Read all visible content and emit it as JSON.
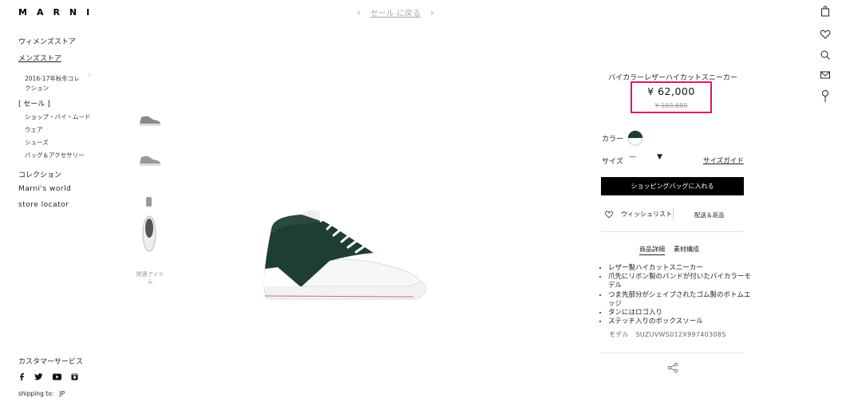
{
  "brand": "MARNI",
  "topnav": {
    "prev": "‹",
    "back_label": "セール に戻る",
    "next": "›"
  },
  "leftnav": {
    "womens": "ウィメンズストア",
    "mens": "メンズストア",
    "collection_2016_line1": "2016-17年秋冬コレ",
    "collection_2016_line2": "クション",
    "sale": "[ セール ]",
    "sale_items": [
      "ショップ・バイ・ムード",
      "ウェア",
      "シューズ",
      "バッグ＆アクセサリー"
    ],
    "collection": "コレクション",
    "marni_world": "Marni's world",
    "store_locator": "store locator"
  },
  "related_items": "関連アイテム",
  "product": {
    "title": "バイカラーレザーハイカットスニーカー",
    "price": "¥ 62,000",
    "old_price": "¥ 103,680",
    "color_label": "カラー",
    "size_label": "サイズ",
    "size_value": "—",
    "size_guide": "サイズガイド",
    "cart_button": "ショッピングバッグに入れる",
    "wishlist": "ウィッシュリスト",
    "shipping": "配送＆返品",
    "tab_details": "商品詳細",
    "tab_material": "素材構成",
    "features": [
      "レザー製ハイカットスニーカー",
      "爪先にリボン製のバンドが付いたバイカラーモデル",
      "つま先部分がシェイプされたゴム製のボトムエッジ",
      "タンにはロゴ入り",
      "ステッチ入りのボックスソール"
    ],
    "model_label": "モデル",
    "model_code": "SUZUVWS012X99740308S"
  },
  "footer": {
    "customer_service": "カスタマーサービス",
    "shipping_to_label": "shipping to:",
    "shipping_to_value": "JP"
  },
  "colors": {
    "accent_highlight": "#e0146e",
    "button": "#000000"
  }
}
